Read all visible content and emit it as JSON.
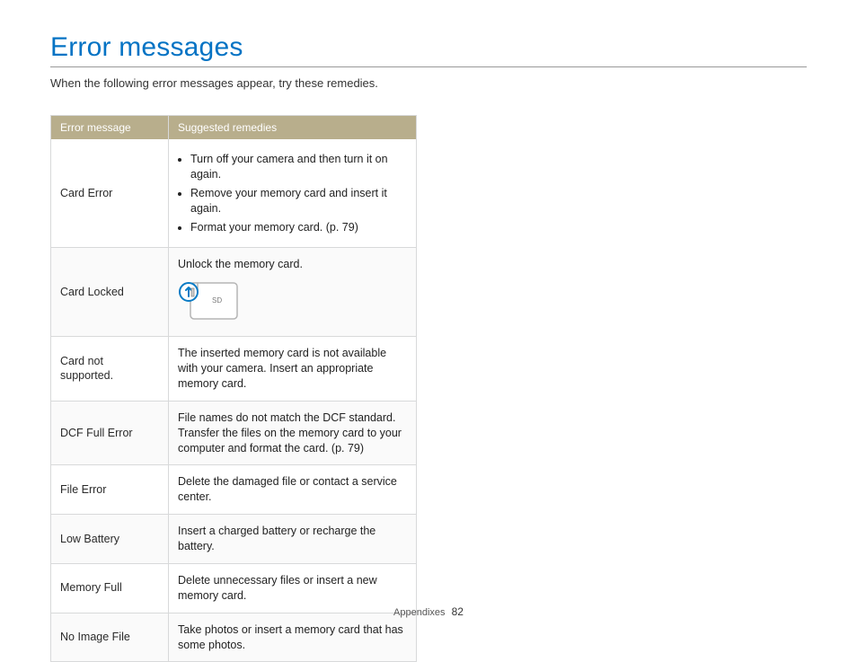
{
  "title": "Error messages",
  "intro": "When the following error messages appear, try these remedies.",
  "headers": {
    "col1": "Error message",
    "col2": "Suggested remedies"
  },
  "rows": [
    {
      "msg": "Card Error",
      "bullets": [
        "Turn off your camera and then turn it on again.",
        "Remove your memory card and insert it again.",
        "Format your memory card. (p. 79)"
      ]
    },
    {
      "msg": "Card Locked",
      "text": "Unlock the memory card.",
      "sd_label": "SD"
    },
    {
      "msg": "Card not supported.",
      "text": "The inserted memory card is not available with your camera. Insert an appropriate memory card."
    },
    {
      "msg": "DCF Full Error",
      "text": "File names do not match the DCF standard. Transfer the files on the memory card to your computer and format the card. (p. 79)"
    },
    {
      "msg": "File Error",
      "text": "Delete the damaged file or contact a service center."
    },
    {
      "msg": "Low Battery",
      "text": "Insert a charged battery or recharge the battery."
    },
    {
      "msg": "Memory Full",
      "text": "Delete unnecessary files or insert a new memory card."
    },
    {
      "msg": "No Image File",
      "text": "Take photos or insert a memory card that has some photos."
    }
  ],
  "footer": {
    "section": "Appendixes",
    "page": "82"
  }
}
